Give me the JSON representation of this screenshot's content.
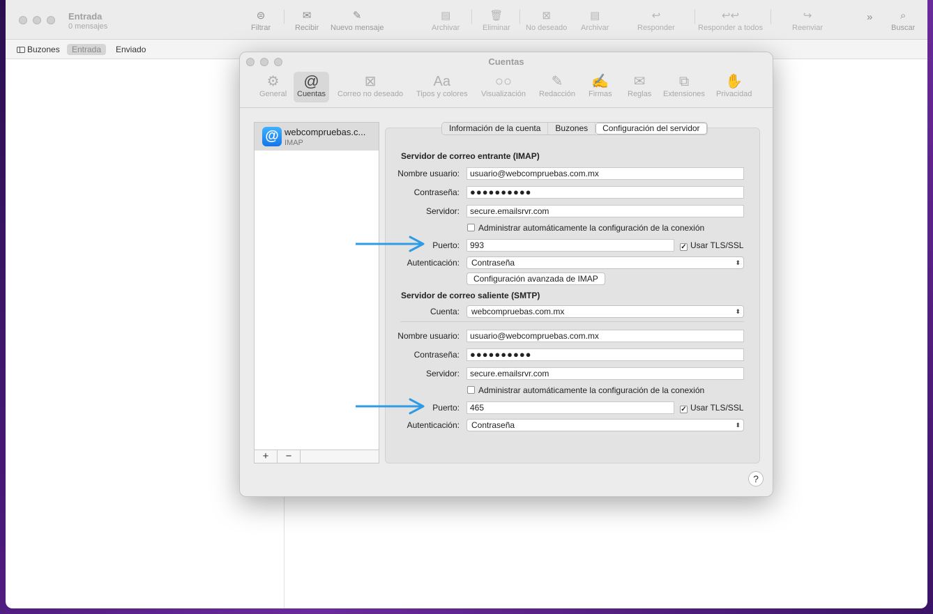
{
  "mail": {
    "title": "Entrada",
    "subtitle": "0 mensajes",
    "toolbar": {
      "filter": "Filtrar",
      "receive": "Recibir",
      "new_message": "Nuevo mensaje",
      "archive": "Archivar",
      "delete": "Eliminar",
      "junk": "No deseado",
      "archive2": "Archivar",
      "reply": "Responder",
      "reply_all": "Responder a todos",
      "forward": "Reenviar",
      "search": "Buscar"
    },
    "favorites": {
      "mailboxes": "Buzones",
      "inbox": "Entrada",
      "sent": "Enviado"
    }
  },
  "dialog": {
    "title": "Cuentas",
    "tabs": [
      {
        "label": "General",
        "icon": "gear-icon",
        "glyph": "⚙"
      },
      {
        "label": "Cuentas",
        "icon": "at-icon",
        "glyph": "@"
      },
      {
        "label": "Correo no deseado",
        "icon": "junk-tray-icon",
        "glyph": "⊠"
      },
      {
        "label": "Tipos y colores",
        "icon": "fonts-icon",
        "glyph": "Aa"
      },
      {
        "label": "Visualización",
        "icon": "glasses-icon",
        "glyph": "○○"
      },
      {
        "label": "Redacción",
        "icon": "compose-icon",
        "glyph": "✎"
      },
      {
        "label": "Firmas",
        "icon": "signature-icon",
        "glyph": "✍"
      },
      {
        "label": "Reglas",
        "icon": "rules-envelope-icon",
        "glyph": "✉"
      },
      {
        "label": "Extensiones",
        "icon": "puzzle-icon",
        "glyph": "⧉"
      },
      {
        "label": "Privacidad",
        "icon": "hand-icon",
        "glyph": "✋"
      }
    ],
    "account": {
      "name": "webcompruebas.c...",
      "type": "IMAP",
      "add": "+",
      "remove": "−"
    },
    "segments": {
      "info": "Información de la cuenta",
      "mailboxes": "Buzones",
      "server": "Configuración del servidor"
    },
    "incoming": {
      "heading": "Servidor de correo entrante (IMAP)",
      "username_label": "Nombre usuario:",
      "username": "usuario@webcompruebas.com.mx",
      "password_label": "Contraseña:",
      "password": "●●●●●●●●●●",
      "server_label": "Servidor:",
      "server": "secure.emailsrvr.com",
      "auto_manage": "Administrar automáticamente la configuración de la conexión",
      "port_label": "Puerto:",
      "port": "993",
      "tls": "Usar TLS/SSL",
      "auth_label": "Autenticación:",
      "auth": "Contraseña",
      "advanced": "Configuración avanzada de IMAP"
    },
    "outgoing": {
      "heading": "Servidor de correo saliente (SMTP)",
      "account_label": "Cuenta:",
      "account": "webcompruebas.com.mx",
      "username_label": "Nombre usuario:",
      "username": "usuario@webcompruebas.com.mx",
      "password_label": "Contraseña:",
      "password": "●●●●●●●●●●",
      "server_label": "Servidor:",
      "server": "secure.emailsrvr.com",
      "auto_manage": "Administrar automáticamente la configuración de la conexión",
      "port_label": "Puerto:",
      "port": "465",
      "tls": "Usar TLS/SSL",
      "auth_label": "Autenticación:",
      "auth": "Contraseña"
    },
    "help": "?"
  },
  "colors": {
    "arrow": "#2f9be6",
    "account_icon": "#1e8ef5"
  }
}
